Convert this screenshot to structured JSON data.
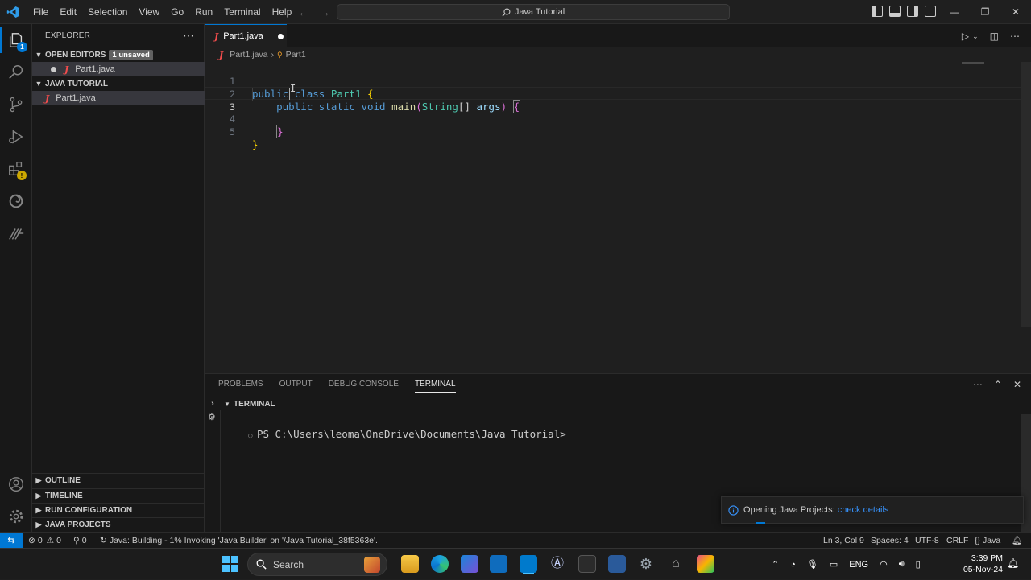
{
  "titlebar": {
    "menu": [
      "File",
      "Edit",
      "Selection",
      "View",
      "Go",
      "Run",
      "Terminal",
      "Help"
    ],
    "search": "Java Tutorial"
  },
  "sidebar": {
    "title": "EXPLORER",
    "open_editors": {
      "label": "OPEN EDITORS",
      "badge": "1 unsaved",
      "files": [
        "Part1.java"
      ]
    },
    "folder": {
      "label": "JAVA TUTORIAL",
      "files": [
        "Part1.java"
      ]
    },
    "bottom_sections": [
      "OUTLINE",
      "TIMELINE",
      "RUN CONFIGURATION",
      "JAVA PROJECTS"
    ]
  },
  "activity_badges": {
    "explorer": "1"
  },
  "editor": {
    "tab": {
      "filename": "Part1.java",
      "dirty": true
    },
    "breadcrumb": {
      "file": "Part1.java",
      "symbol": "Part1"
    },
    "lines": [
      {
        "n": "1",
        "text": "public class Part1 {"
      },
      {
        "n": "2",
        "text": "    public static void main(String[] args) {"
      },
      {
        "n": "3",
        "text": ""
      },
      {
        "n": "4",
        "text": "    }"
      },
      {
        "n": "5",
        "text": "}"
      }
    ],
    "current_line": 3
  },
  "panel": {
    "tabs": [
      "PROBLEMS",
      "OUTPUT",
      "DEBUG CONSOLE",
      "TERMINAL"
    ],
    "active_tab": "TERMINAL",
    "terminal_header": "TERMINAL",
    "prompt": "PS C:\\Users\\leoma\\OneDrive\\Documents\\Java Tutorial>"
  },
  "notification": {
    "text": "Opening Java Projects: ",
    "link": "check details"
  },
  "statusbar": {
    "errors": "0",
    "warnings": "0",
    "ports": "0",
    "task": "Java: Building - 1% Invoking 'Java Builder' on '/Java Tutorial_38f5363e'.",
    "position": "Ln 3, Col 9",
    "spaces": "Spaces: 4",
    "encoding": "UTF-8",
    "eol": "CRLF",
    "language": "Java"
  },
  "taskbar": {
    "search": "Search",
    "lang": "ENG",
    "time": "3:39 PM",
    "date": "05-Nov-24"
  },
  "colors": {
    "accent": "#0078d4",
    "keyword": "#569cd6",
    "class": "#4ec9b0",
    "function": "#dcdcaa",
    "param": "#9cdcfe",
    "java_icon": "#f14c4c"
  }
}
